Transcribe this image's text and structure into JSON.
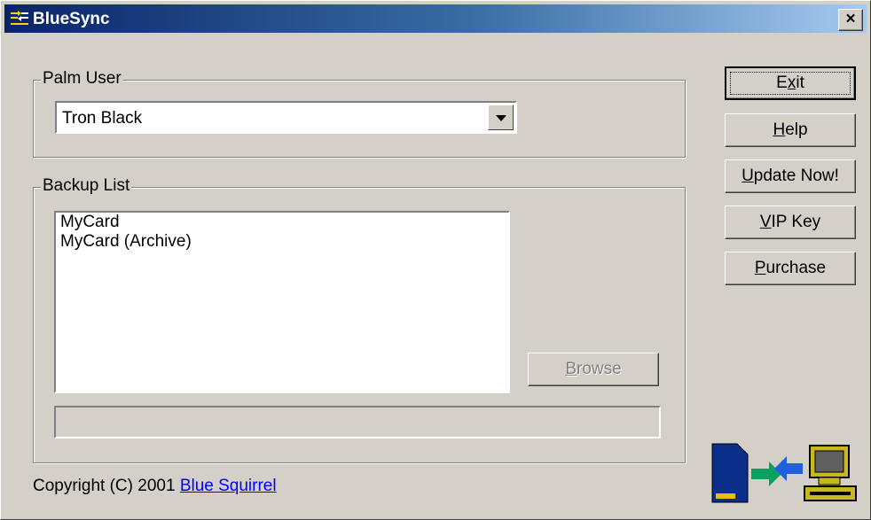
{
  "window": {
    "title": "BlueSync",
    "close_label": "×"
  },
  "palm_user": {
    "legend": "Palm User",
    "selected": "Tron Black"
  },
  "backup_list": {
    "legend": "Backup List",
    "items": [
      "MyCard",
      "MyCard (Archive)"
    ],
    "browse_label": "Browse"
  },
  "buttons": {
    "exit": {
      "pre": "E",
      "ul": "x",
      "post": "it"
    },
    "help": {
      "pre": "",
      "ul": "H",
      "post": "elp"
    },
    "update": {
      "pre": "",
      "ul": "U",
      "post": "pdate Now!"
    },
    "vip": {
      "pre": "",
      "ul": "V",
      "post": "IP Key"
    },
    "purchase": {
      "pre": "",
      "ul": "P",
      "post": "urchase"
    },
    "browse": {
      "pre": "",
      "ul": "B",
      "post": "rowse"
    }
  },
  "footer": {
    "copyright": "Copyright (C) 2001",
    "link": "Blue Squirrel"
  },
  "colors": {
    "face": "#d4d0c8",
    "title_start": "#0a246a",
    "title_end": "#a6caf0",
    "link": "#0000ff"
  }
}
